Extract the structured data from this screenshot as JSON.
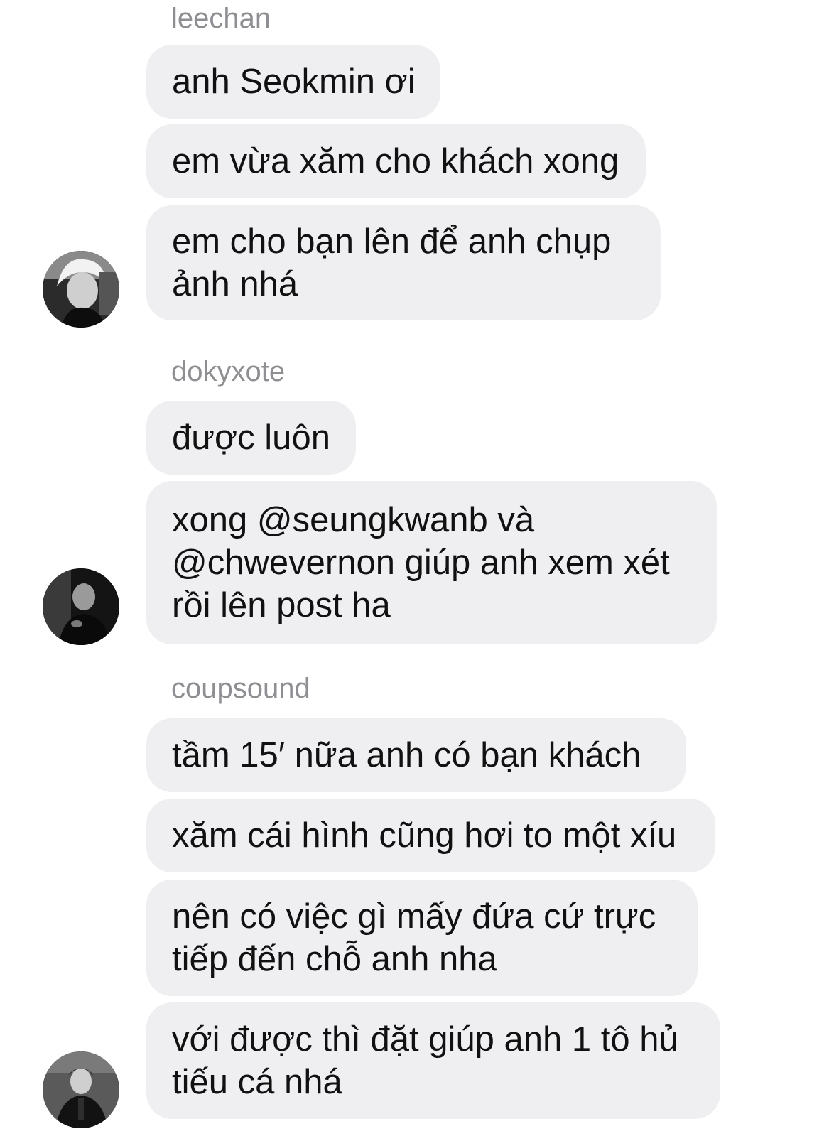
{
  "groups": [
    {
      "sender": "leechan",
      "avatar_icon": "profile-photo-leechan",
      "messages": [
        {
          "lines": [
            "anh Seokmin ơi"
          ]
        },
        {
          "lines": [
            "em vừa xăm cho khách xong"
          ]
        },
        {
          "lines": [
            "em cho bạn lên để anh chụp",
            "ảnh nhá"
          ]
        }
      ]
    },
    {
      "sender": "dokyxote",
      "avatar_icon": "profile-photo-dokyxote",
      "messages": [
        {
          "lines": [
            "được luôn"
          ]
        },
        {
          "lines": [
            "xong @seungkwanb và",
            "@chwevernon giúp anh xem xét",
            "rồi lên post ha"
          ]
        }
      ]
    },
    {
      "sender": "coupsound",
      "avatar_icon": "profile-photo-coupsound",
      "messages": [
        {
          "lines": [
            "tầm 15′ nữa anh có bạn khách"
          ]
        },
        {
          "lines": [
            "xăm cái hình cũng hơi to một xíu"
          ]
        },
        {
          "lines": [
            "nên có việc gì mấy đứa cứ trực",
            "tiếp đến chỗ anh nha"
          ]
        },
        {
          "lines": [
            "với được thì đặt giúp anh 1 tô hủ",
            "tiếu cá nhá"
          ]
        }
      ]
    }
  ],
  "colors": {
    "bubble": "#efeff1",
    "sender_name": "#8e8e93",
    "text": "#111111"
  }
}
